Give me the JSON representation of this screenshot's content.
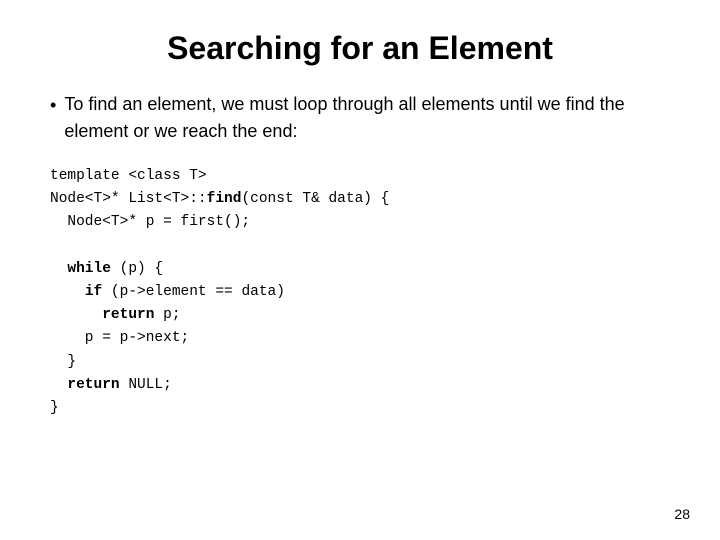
{
  "slide": {
    "title": "Searching for an Element",
    "bullet": {
      "text": "To find an element, we must loop through all elements until we find the element or we reach the end:"
    },
    "code": {
      "line1": "template <class T>",
      "line2": "Node<T>* List<T>::find(const T& data) {",
      "line3": "  Node<T>* p = first();",
      "line4": "",
      "line5": "  while (p) {",
      "line6": "    if (p->element == data)",
      "line7": "      return p;",
      "line8": "    p = p->next;",
      "line9": "  }",
      "line10": "  return NULL;",
      "line11": "}"
    },
    "page_number": "28"
  }
}
